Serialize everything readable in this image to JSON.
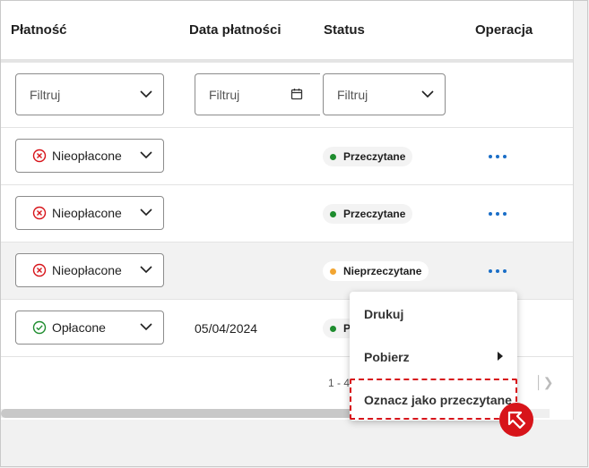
{
  "table": {
    "headers": [
      "Płatność",
      "Data płatności",
      "Status",
      "Operacja"
    ],
    "filters": {
      "payment_placeholder": "Filtruj",
      "date_placeholder": "Filtruj",
      "status_placeholder": "Filtruj"
    },
    "rows": [
      {
        "payment": "Nieopłacone",
        "payment_state": "unpaid",
        "date": "",
        "status": "Przeczytane",
        "status_color": "#1e8c2e"
      },
      {
        "payment": "Nieopłacone",
        "payment_state": "unpaid",
        "date": "",
        "status": "Przeczytane",
        "status_color": "#1e8c2e"
      },
      {
        "payment": "Nieopłacone",
        "payment_state": "unpaid",
        "date": "",
        "status": "Nieprzeczytane",
        "status_color": "#f2a531"
      },
      {
        "payment": "Opłacone",
        "payment_state": "paid",
        "date": "05/04/2024",
        "status": "P",
        "status_color": "#1e8c2e"
      }
    ],
    "pagination_text": "1 - 4"
  },
  "context_menu": {
    "items": [
      "Drukuj",
      "Pobierz",
      "Oznacz jako przeczytane"
    ]
  },
  "colors": {
    "unpaid_icon": "#d7141a",
    "paid_icon": "#1e8c2e",
    "accent": "#1a6ec7",
    "highlight": "#d7141a"
  }
}
